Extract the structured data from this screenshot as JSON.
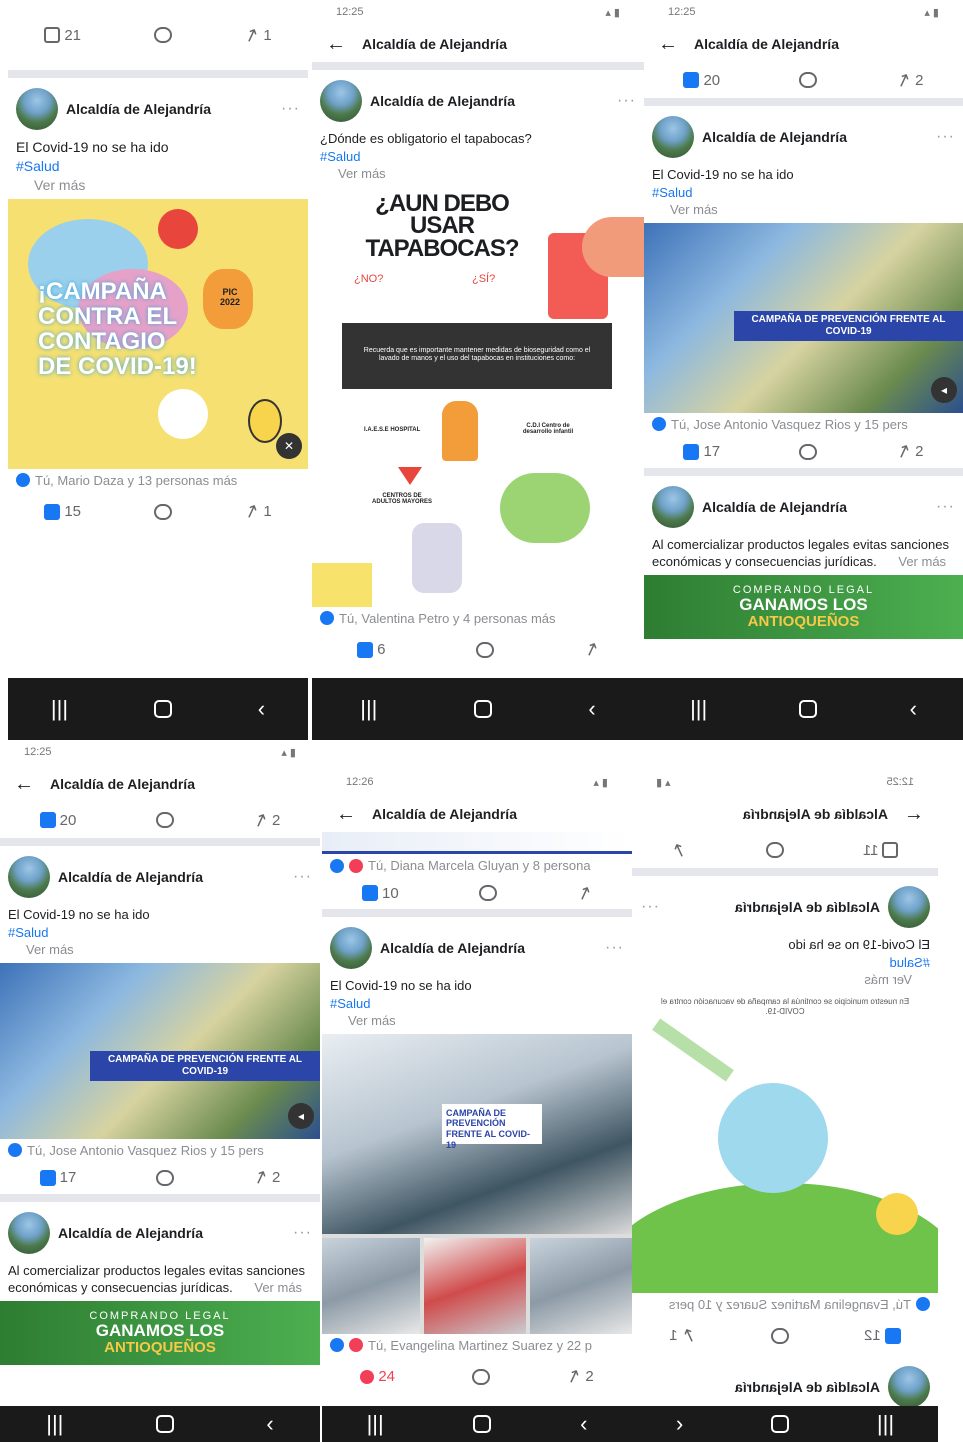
{
  "common": {
    "page_name": "Alcaldía de Alejandría",
    "hashtag": "#Salud",
    "ver_mas": "Ver más",
    "covid_text": "El Covid-19 no se ha ido",
    "commercial_text": "Al comercializar productos legales evitas sanciones económicas y consecuencias jurídicas.",
    "status_time": "12:25",
    "status_time_b": "12:26"
  },
  "panel1": {
    "top_likes": "21",
    "top_shares": "1",
    "image_title": "¡CAMPAÑA CONTRA EL CONTAGIO DE COVID-19!",
    "image_badge": "PIC 2022",
    "reactions": "Tú, Mario Daza y 13 personas más",
    "likes": "15",
    "shares": "1"
  },
  "panel2": {
    "question": "¿Dónde es obligatorio el tapabocas?",
    "image_title": "¿AUN DEBO USAR TAPABOCAS?",
    "no": "¿NO?",
    "si": "¿SÍ?",
    "box_text": "Recuerda que es importante mantener medidas de bioseguridad como el lavado de manos y el uso del tapabocas en instituciones como:",
    "hospital": "I.A.E.S.E HOSPITAL",
    "cdi": "C.D.I Centro de desarrollo infantil",
    "adultos": "CENTROS DE ADULTOS MAYORES",
    "reactions": "Tú, Valentina Petro y 4 personas más",
    "likes": "6"
  },
  "panel3": {
    "top_likes": "20",
    "top_shares": "2",
    "video_banner": "CAMPAÑA DE PREVENCIÓN FRENTE AL COVID-19",
    "reactions": "Tú, Jose Antonio Vasquez Rios y 15 pers",
    "likes": "17",
    "shares": "2",
    "banner_small": "COMPRANDO LEGAL",
    "banner_big": "GANAMOS LOS",
    "banner_gold": "ANTIOQUEÑOS"
  },
  "panel5": {
    "reactions_top": "Tú, Diana Marcela Gluyan y 8 persona",
    "likes_top": "10",
    "photo_banner": "CAMPAÑA DE PREVENCIÓN FRENTE AL COVID-19",
    "reactions": "Tú, Evangelina Martinez Suarez y 22 p",
    "loves": "24",
    "shares": "2"
  },
  "panel6": {
    "top_likes": "11",
    "vaccine_text": "En nuestro municipio se continúa la campaña de vacunación contra el COVID-19.",
    "reactions": "Tú, Evangelina Martinez Suarez y 10 pers",
    "likes": "12",
    "shares": "1"
  }
}
